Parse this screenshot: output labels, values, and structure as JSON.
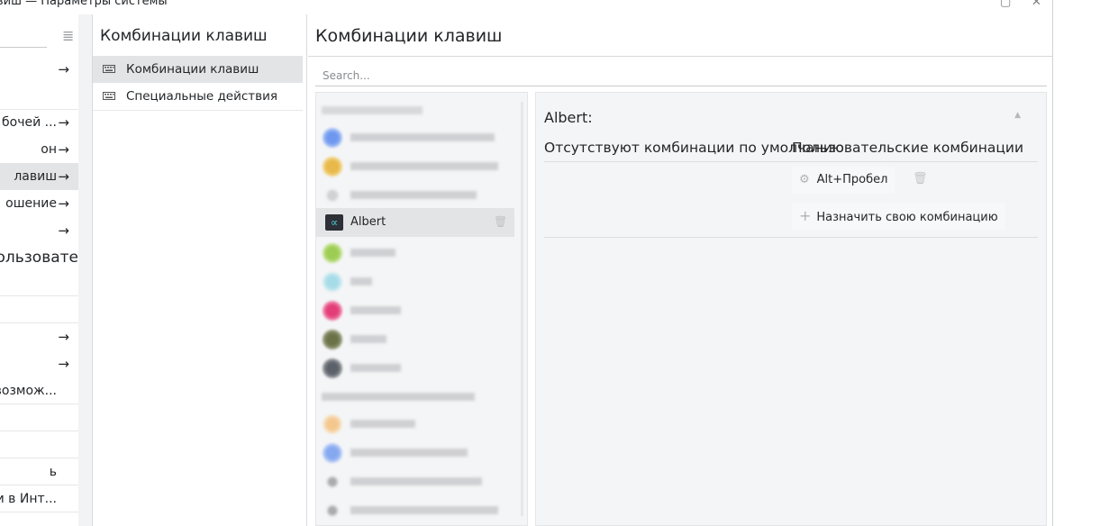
{
  "window": {
    "title": "виш — Параметры системы",
    "maximize_icon": "maximize-icon",
    "close_icon": "close-icon",
    "close_glyph": "✕",
    "maximize_glyph": "▢"
  },
  "sidebar": {
    "menu_icon": "hamburger-menu-icon",
    "menu_glyph": "≣",
    "items": [
      {
        "label": "",
        "arrow": "→"
      },
      {
        "label": "",
        "arrow": ""
      },
      {
        "label": "бочей ...",
        "arrow": "→"
      },
      {
        "label": "он",
        "arrow": "→"
      },
      {
        "label": "лавиш",
        "arrow": "→"
      },
      {
        "label": "ошение",
        "arrow": "→"
      },
      {
        "label": "",
        "arrow": "→"
      },
      {
        "label": "пользовате",
        "arrow": ""
      },
      {
        "label": "",
        "arrow": ""
      },
      {
        "label": "",
        "arrow": ""
      },
      {
        "label": "",
        "arrow": "→"
      },
      {
        "label": "",
        "arrow": "→"
      },
      {
        "label": "возмож...",
        "arrow": ""
      },
      {
        "label": "",
        "arrow": ""
      },
      {
        "label": "",
        "arrow": ""
      },
      {
        "label": "ь",
        "arrow": ""
      },
      {
        "label": "и в Инт...",
        "arrow": ""
      }
    ]
  },
  "column2": {
    "heading": "Комбинации клавиш",
    "items": [
      {
        "label": "Комбинации клавиш",
        "icon": "keyboard-icon"
      },
      {
        "label": "Специальные действия",
        "icon": "keyboard-icon"
      }
    ]
  },
  "main": {
    "heading": "Комбинации клавиш",
    "search_placeholder": "Search...",
    "apps": {
      "selected_name": "Albert",
      "selected_icon_glyph": "∝",
      "delete_icon": "trash-icon",
      "delete_glyph": "🗑"
    },
    "detail": {
      "app_label": "Albert:",
      "no_defaults": "Отсутствуют комбинации по умолчанию",
      "custom_label": "Пользовательские комбинации",
      "shortcut": "Alt+Пробел",
      "shortcut_icon_glyph": "⚙",
      "assign_label": "Назначить свою комбинацию",
      "assign_icon_glyph": "+",
      "trash_glyph": "🗑",
      "collapse_glyph": "▲"
    }
  },
  "colors": {
    "accent_selection": "#e3e4e6",
    "panel_bg": "#f4f5f6",
    "text": "#232629"
  }
}
